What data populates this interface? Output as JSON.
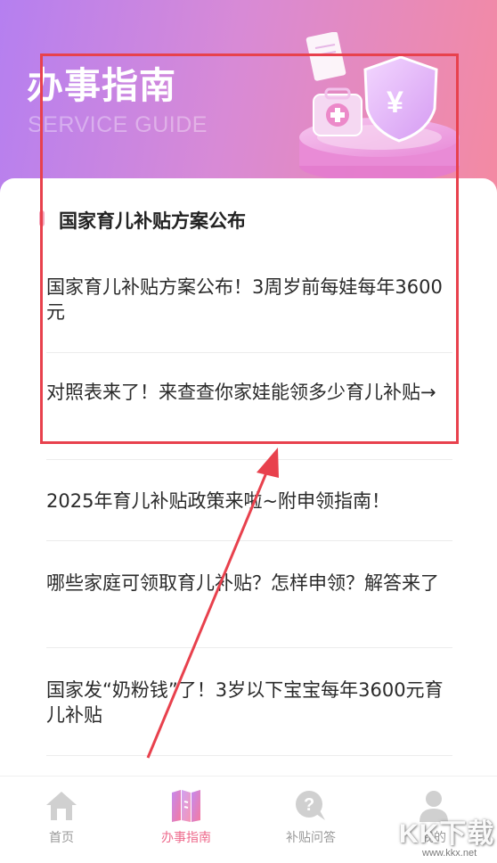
{
  "hero": {
    "title": "办事指南",
    "subtitle": "SERVICE GUIDE"
  },
  "section": {
    "heading": "国家育儿补贴方案公布"
  },
  "articles": [
    {
      "title": "国家育儿补贴方案公布！3周岁前每娃每年3600元"
    },
    {
      "title": "对照表来了！来查查你家娃能领多少育儿补贴→"
    },
    {
      "title": "2025年育儿补贴政策来啦~附申领指南！"
    },
    {
      "title": "哪些家庭可领取育儿补贴？怎样申领？解答来了"
    },
    {
      "title": "国家发“奶粉钱”了！3岁以下宝宝每年3600元育儿补贴"
    }
  ],
  "tabbar": {
    "items": [
      {
        "label": "首页",
        "icon": "home-icon",
        "active": false
      },
      {
        "label": "办事指南",
        "icon": "guide-book-icon",
        "active": true
      },
      {
        "label": "补贴问答",
        "icon": "question-bubble-icon",
        "active": false
      },
      {
        "label": "我的",
        "icon": "user-icon",
        "active": false
      }
    ]
  },
  "watermark": {
    "text": "KK下载",
    "url": "www.kkx.net"
  },
  "colors": {
    "accent": "#ee6a8c",
    "annotation": "#e8414d",
    "hero_start": "#b57ff0",
    "hero_end": "#f58aa0"
  }
}
